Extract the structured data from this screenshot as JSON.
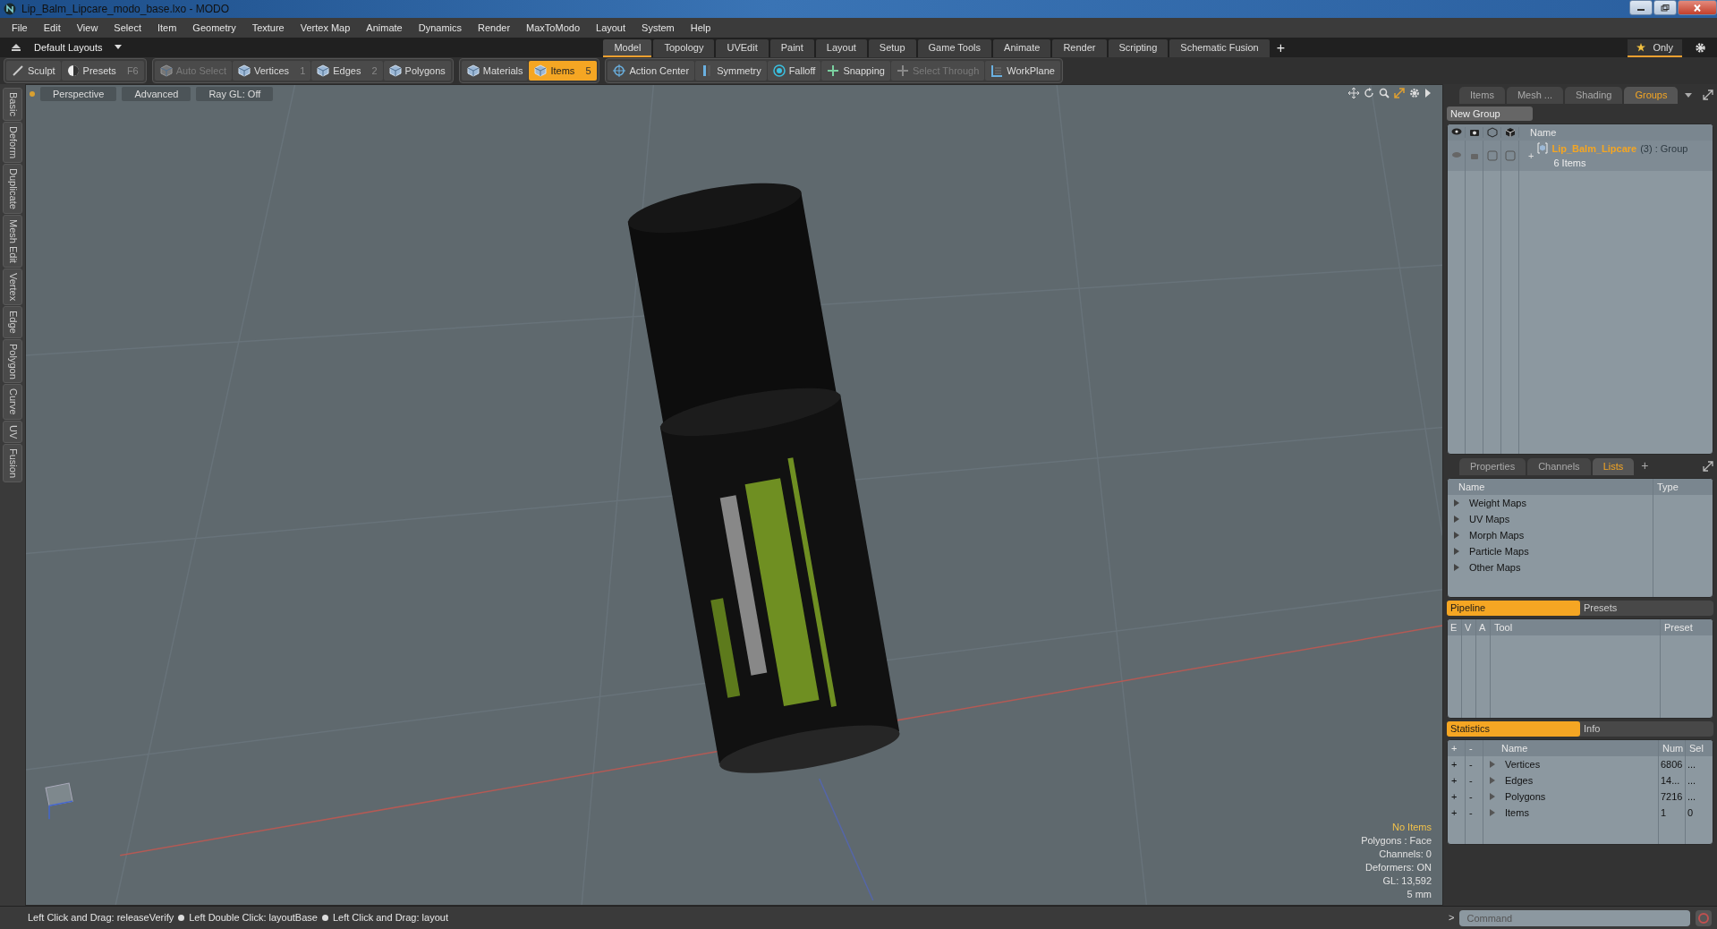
{
  "window": {
    "title": "Lip_Balm_Lipcare_modo_base.lxo - MODO"
  },
  "menu": [
    "File",
    "Edit",
    "View",
    "Select",
    "Item",
    "Geometry",
    "Texture",
    "Vertex Map",
    "Animate",
    "Dynamics",
    "Render",
    "MaxToModo",
    "Layout",
    "System",
    "Help"
  ],
  "layout_bar": {
    "layout_menu": "Default Layouts",
    "tabs": [
      {
        "label": "Model",
        "selected": true
      },
      {
        "label": "Topology",
        "selected": false
      },
      {
        "label": "UVEdit",
        "selected": false
      },
      {
        "label": "Paint",
        "selected": false
      },
      {
        "label": "Layout",
        "selected": false
      },
      {
        "label": "Setup",
        "selected": false
      },
      {
        "label": "Game Tools",
        "selected": false
      },
      {
        "label": "Animate",
        "selected": false
      },
      {
        "label": "Render",
        "selected": false
      },
      {
        "label": "Scripting",
        "selected": false
      },
      {
        "label": "Schematic Fusion",
        "selected": false
      }
    ],
    "add": "+",
    "only": "Only"
  },
  "toolbar": [
    {
      "items": [
        {
          "label": "Sculpt",
          "kind": "brush",
          "selected": false,
          "disabled": false
        },
        {
          "label": "Presets",
          "key": "F6",
          "kind": "disc",
          "selected": false,
          "disabled": false
        }
      ]
    },
    {
      "items": [
        {
          "label": "Auto Select",
          "kind": "cube",
          "selected": false,
          "disabled": true
        },
        {
          "label": "Vertices",
          "key": "1",
          "kind": "cube",
          "selected": false,
          "disabled": false
        },
        {
          "label": "Edges",
          "key": "2",
          "kind": "cube",
          "selected": false,
          "disabled": false
        },
        {
          "label": "Polygons",
          "kind": "cube",
          "selected": false,
          "disabled": false
        }
      ]
    },
    {
      "items": [
        {
          "label": "Materials",
          "kind": "cube",
          "selected": false,
          "disabled": false
        },
        {
          "label": "Items",
          "key": "5",
          "kind": "cube",
          "selected": true,
          "disabled": false
        }
      ]
    },
    {
      "items": [
        {
          "label": "Action Center",
          "kind": "crosshair",
          "selected": false,
          "disabled": false
        },
        {
          "label": "Symmetry",
          "kind": "symmetry",
          "selected": false,
          "disabled": false
        },
        {
          "label": "Falloff",
          "kind": "rings",
          "selected": false,
          "disabled": false
        },
        {
          "label": "Snapping",
          "kind": "snap",
          "selected": false,
          "disabled": false
        },
        {
          "label": "Select Through",
          "kind": "snap",
          "selected": false,
          "disabled": true
        },
        {
          "label": "WorkPlane",
          "kind": "grid",
          "selected": false,
          "disabled": false
        }
      ]
    }
  ],
  "side_tabs": [
    "Basic",
    "Deform",
    "Duplicate",
    "Mesh Edit",
    "Vertex",
    "Edge",
    "Polygon",
    "Curve",
    "UV",
    "Fusion"
  ],
  "viewport": {
    "buttons": [
      "Perspective",
      "Advanced",
      "Ray GL: Off"
    ],
    "info": [
      {
        "text": "No Items",
        "kind": "highlight"
      },
      {
        "text": "Polygons : Face",
        "kind": "normal"
      },
      {
        "text": "Channels: 0",
        "kind": "normal"
      },
      {
        "text": "Deformers: ON",
        "kind": "normal"
      },
      {
        "text": "GL: 13,592",
        "kind": "normal"
      },
      {
        "text": "5 mm",
        "kind": "normal"
      }
    ]
  },
  "groups_panel": {
    "tabs": [
      {
        "label": "Items",
        "selected": false
      },
      {
        "label": "Mesh ...",
        "selected": false
      },
      {
        "label": "Shading",
        "selected": false
      },
      {
        "label": "Groups",
        "selected": true
      }
    ],
    "new_group": "New Group",
    "column": "Name",
    "rows": [
      {
        "expander": "+",
        "name": "Lip_Balm_Lipcare",
        "type": "(3) : Group",
        "detail": "6 Items"
      }
    ]
  },
  "lists_panel": {
    "tabs": [
      {
        "label": "Properties",
        "selected": false
      },
      {
        "label": "Channels",
        "selected": false
      },
      {
        "label": "Lists",
        "selected": true
      }
    ],
    "add": "+",
    "columns": [
      "Name",
      "Type"
    ],
    "items": [
      "Weight Maps",
      "UV Maps",
      "Morph Maps",
      "Particle Maps",
      "Other Maps"
    ]
  },
  "pipeline": {
    "tabs": [
      {
        "label": "Pipeline",
        "selected": true
      },
      {
        "label": "Presets",
        "selected": false
      }
    ],
    "columns": [
      "E",
      "V",
      "A",
      "Tool",
      "Preset"
    ]
  },
  "statistics": {
    "tabs": [
      {
        "label": "Statistics",
        "selected": true
      },
      {
        "label": "Info",
        "selected": false
      }
    ],
    "columns": [
      "+",
      "-",
      "Name",
      "Num",
      "Sel"
    ],
    "rows": [
      {
        "add": "+",
        "remove": "-",
        "name": "Vertices",
        "num": "6806",
        "sel": "..."
      },
      {
        "add": "+",
        "remove": "-",
        "name": "Edges",
        "num": "14...",
        "sel": "..."
      },
      {
        "add": "+",
        "remove": "-",
        "name": "Polygons",
        "num": "7216",
        "sel": "..."
      },
      {
        "add": "+",
        "remove": "-",
        "name": "Items",
        "num": "1",
        "sel": "0"
      }
    ]
  },
  "command": {
    "prompt": ">",
    "placeholder": "Command"
  },
  "status_bar": {
    "hints": [
      "Left Click and Drag: releaseVerify",
      "Left Double Click: layoutBase",
      "Left Click and Drag: layout"
    ]
  }
}
